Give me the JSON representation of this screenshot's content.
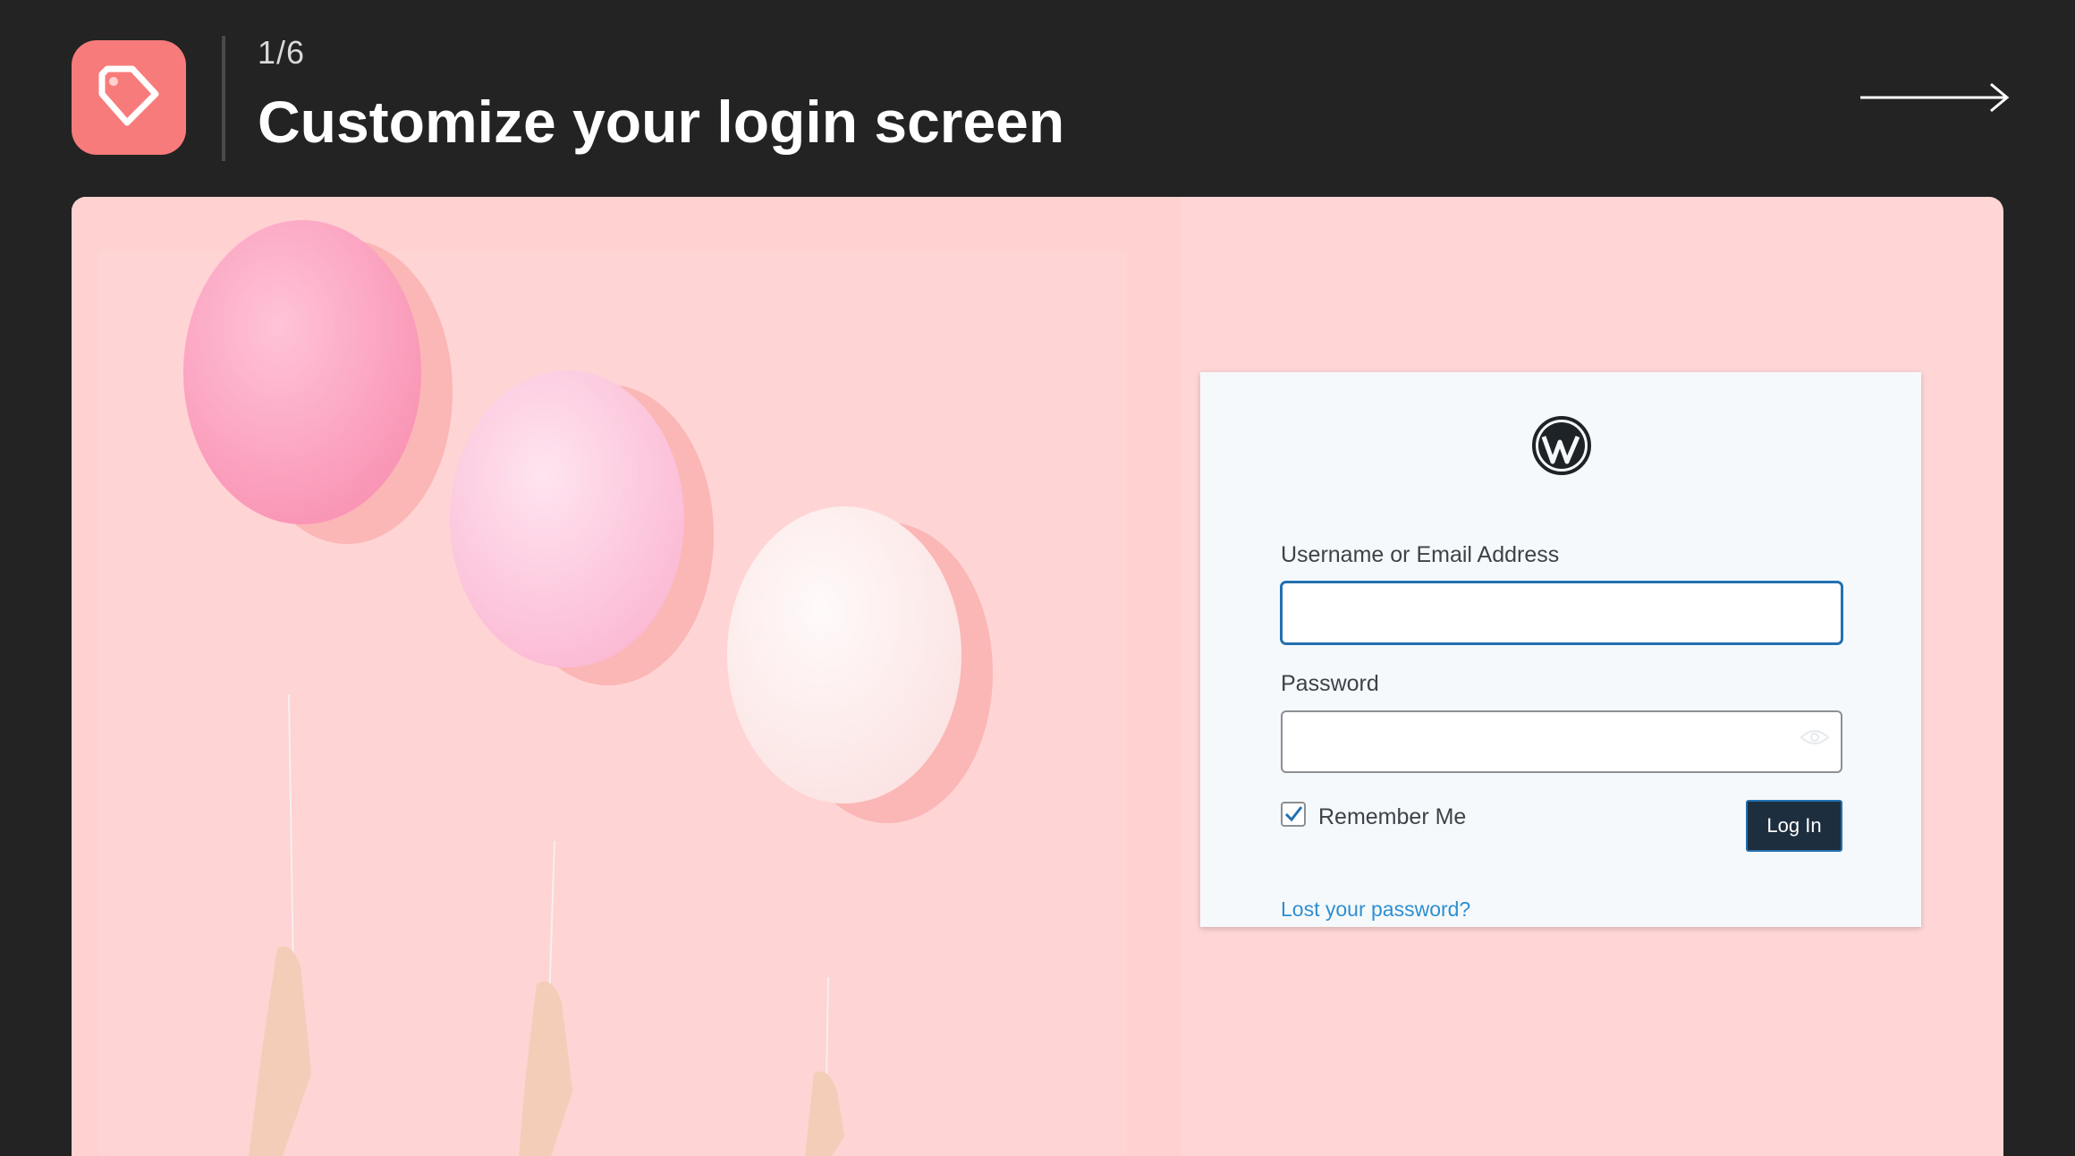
{
  "header": {
    "step": "1/6",
    "title": "Customize your login screen"
  },
  "icons": {
    "app": "tag-icon",
    "next": "arrow-right-icon",
    "logo": "wordpress-logo-icon",
    "password_toggle": "eye-icon",
    "checkbox": "checkmark-icon"
  },
  "login": {
    "username_label": "Username or Email Address",
    "username_value": "",
    "password_label": "Password",
    "password_value": "",
    "remember_label": "Remember Me",
    "remember_checked": true,
    "submit_label": "Log In",
    "lost_password": "Lost your password?"
  },
  "colors": {
    "app_icon_bg": "#f87b7b",
    "page_bg": "#232323",
    "preview_bg": "#ffd5d5",
    "button_bg": "#1d2e3f",
    "link": "#2e8fd1",
    "focus": "#2271b1"
  }
}
